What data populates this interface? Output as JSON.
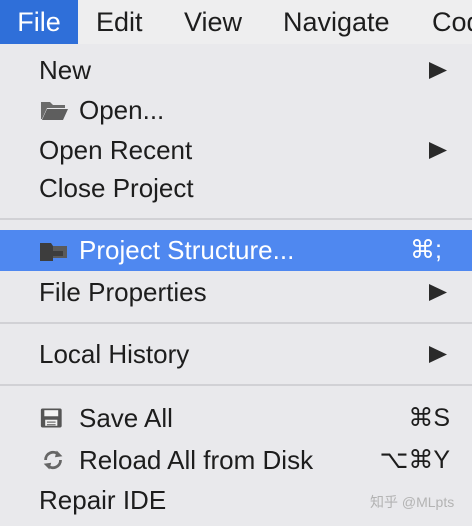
{
  "menubar": {
    "items": [
      {
        "label": "File",
        "active": true
      },
      {
        "label": "Edit"
      },
      {
        "label": "View"
      },
      {
        "label": "Navigate"
      },
      {
        "label": "Cod"
      }
    ]
  },
  "file_menu": {
    "new": {
      "label": "New",
      "submenu_icon": "triangle-right-icon"
    },
    "open": {
      "label": "Open...",
      "icon": "folder-open-icon"
    },
    "open_recent": {
      "label": "Open Recent",
      "submenu_icon": "triangle-right-icon"
    },
    "close_project": {
      "label": "Close Project"
    },
    "project_structure": {
      "label": "Project Structure...",
      "icon": "project-structure-icon",
      "shortcut": "⌘;",
      "highlighted": true
    },
    "file_properties": {
      "label": "File Properties",
      "submenu_icon": "triangle-right-icon"
    },
    "local_history": {
      "label": "Local History",
      "submenu_icon": "triangle-right-icon"
    },
    "save_all": {
      "label": "Save All",
      "icon": "save-icon",
      "shortcut": "⌘S"
    },
    "reload_all": {
      "label": "Reload All from Disk",
      "icon": "reload-icon",
      "shortcut": "⌥⌘Y"
    },
    "repair_ide": {
      "label": "Repair IDE"
    }
  },
  "watermark": "知乎 @MLpts",
  "colors": {
    "menubar_active": "#2f6fd9",
    "highlight": "#4f88f0",
    "menu_bg": "#e9e9ec",
    "text": "#1d1d1d"
  }
}
